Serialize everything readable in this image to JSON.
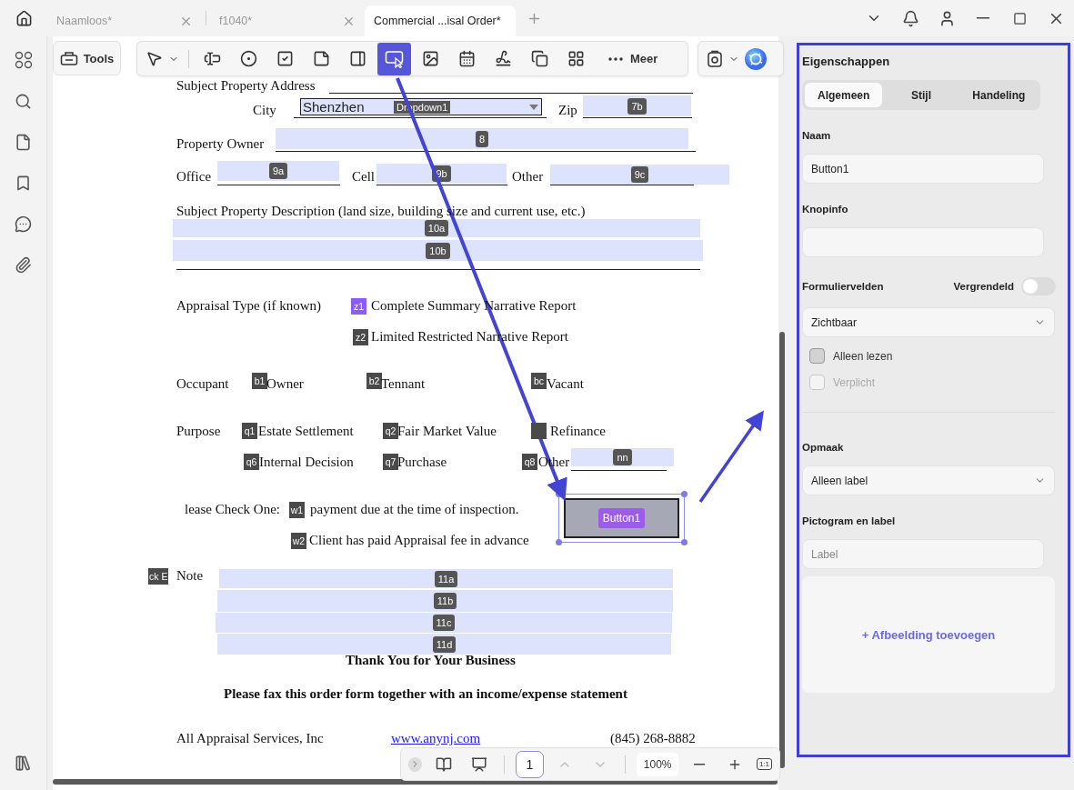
{
  "title_bar": {
    "tabs": [
      {
        "label": "Naamloos*",
        "selected": false
      },
      {
        "label": "f1040*",
        "selected": false
      },
      {
        "label": "Commercial ...isal Order*",
        "selected": true
      }
    ]
  },
  "toolbar": {
    "tools_button": "Tools",
    "more": "Meer",
    "tools": [
      {
        "kind": "select",
        "selected": false
      },
      {
        "kind": "text",
        "selected": false
      },
      {
        "kind": "radio",
        "selected": false
      },
      {
        "kind": "checkbox",
        "selected": false
      },
      {
        "kind": "combo",
        "selected": false
      },
      {
        "kind": "list",
        "selected": false
      },
      {
        "kind": "button",
        "selected": true
      },
      {
        "kind": "image",
        "selected": false
      },
      {
        "kind": "date",
        "selected": false
      },
      {
        "kind": "signature",
        "selected": false
      },
      {
        "kind": "copy",
        "selected": false
      },
      {
        "kind": "grid",
        "selected": false
      }
    ]
  },
  "document": {
    "address_label": "Subject Property Address",
    "city_label": "City",
    "city_dropdown": {
      "value": "Shenzhen",
      "tag": "Dropdown1"
    },
    "zip_label": "Zip",
    "zip_tag": "7b",
    "owner_label": "Property Owner",
    "owner_tag": "8",
    "office_label": "Office",
    "office_tag": "9a",
    "cell_label": "Cell",
    "cell_tag": "9b",
    "other_label": "Other",
    "other_tag": "9c",
    "description_label": "Subject Property Description (land size, building size and current use, etc.)",
    "description_tags": [
      "10a",
      "10b"
    ],
    "appraisal_label": "Appraisal Type (if known)",
    "appraisal_options": [
      {
        "tag": "z1",
        "label": "Complete Summary Narrative Report",
        "color": "#8b5cf6"
      },
      {
        "tag": "z2",
        "label": "Limited Restricted Narrative Report",
        "color": "#4a4a4a"
      }
    ],
    "occupant_label": "Occupant",
    "occupant_options": [
      {
        "tag": "b1",
        "label": "Owner"
      },
      {
        "tag": "b2",
        "label": "Tennant"
      },
      {
        "tag": "bc",
        "label": "Vacant"
      }
    ],
    "purpose_label": "Purpose",
    "purpose_options": [
      {
        "tag": "q1",
        "label": "Estate Settlement"
      },
      {
        "tag": "q2",
        "label": "Fair Market Value"
      },
      {
        "label": "Refinance"
      },
      {
        "tag": "q6",
        "label": "Internal Decision"
      },
      {
        "tag": "q7",
        "label": "Purchase"
      },
      {
        "tag": "q8",
        "label": "Other"
      }
    ],
    "purpose_other_tag": "nn",
    "check_label": "lease Check One:",
    "payment_options": [
      {
        "tag": "w1",
        "label": "payment due at the time of inspection."
      },
      {
        "tag": "w2",
        "label": "Client has paid Appraisal fee in advance"
      }
    ],
    "button_field": {
      "tag": "Button1",
      "selected": true
    },
    "note_cut_tag": "ck E",
    "note_label": "Note",
    "note_tags": [
      "11a",
      "11b",
      "11c",
      "11d"
    ],
    "thank_you": "Thank You for Your Business",
    "fax_note": "Please fax this order form together with an income/expense statement",
    "company": "All Appraisal Services, Inc",
    "website": "www.anynj.com",
    "phone": "(845) 268-8882"
  },
  "page_nav": {
    "page": "1",
    "zoom": "100%",
    "actual_size": "1:1"
  },
  "properties": {
    "title": "Eigenschappen",
    "tabs": [
      {
        "label": "Algemeen",
        "selected": true
      },
      {
        "label": "Stijl",
        "selected": false
      },
      {
        "label": "Handeling",
        "selected": false
      }
    ],
    "name_label": "Naam",
    "name_value": "Button1",
    "tooltip_label": "Knopinfo",
    "form_fields_label": "Formuliervelden",
    "locked_label": "Vergrendeld",
    "locked": false,
    "visibility": "Zichtbaar",
    "checkboxes": [
      {
        "label": "Alleen lezen",
        "checked": false,
        "disabled": false
      },
      {
        "label": "Verplicht",
        "checked": false,
        "disabled": true
      }
    ],
    "layout_label": "Opmaak",
    "layout_value": "Alleen label",
    "icon_label_heading": "Pictogram en label",
    "label_placeholder": "Label",
    "add_image": "+ Afbeelding toevoegen"
  }
}
